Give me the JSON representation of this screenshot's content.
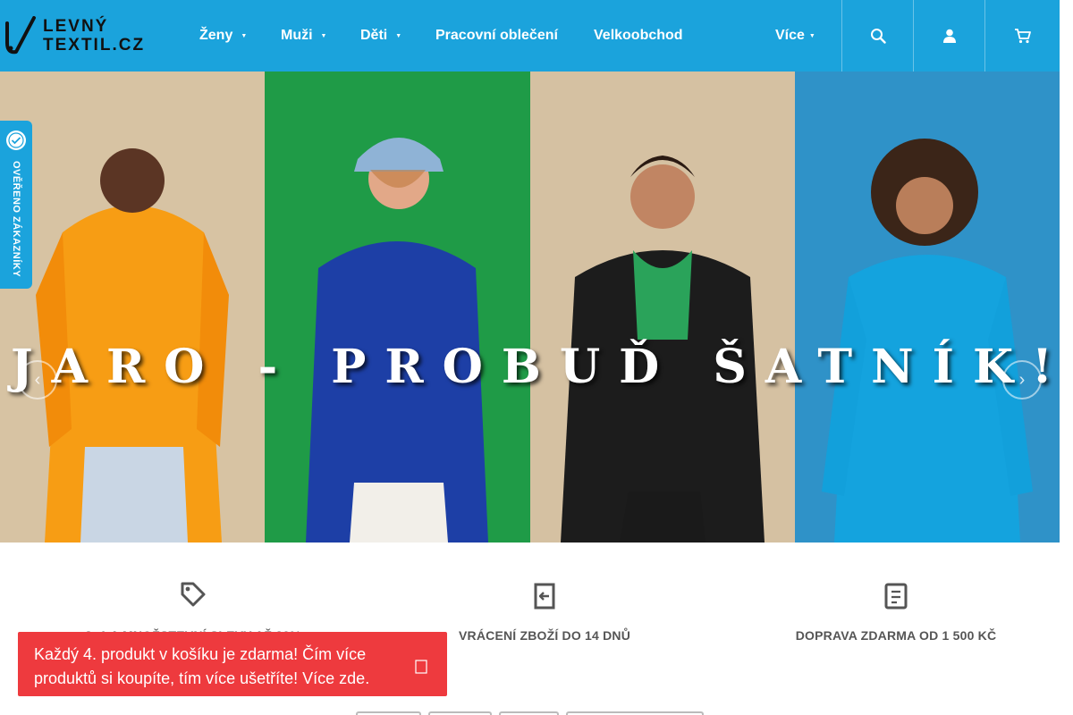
{
  "site": {
    "logo_line1": "LEVNÝ",
    "logo_line2": "TEXTIL.CZ"
  },
  "nav": {
    "items": [
      {
        "label": "Ženy",
        "has_dropdown": true
      },
      {
        "label": "Muži",
        "has_dropdown": true
      },
      {
        "label": "Děti",
        "has_dropdown": true
      },
      {
        "label": "Pracovní oblečení",
        "has_dropdown": false
      },
      {
        "label": "Velkoobchod",
        "has_dropdown": false
      },
      {
        "label": "Více",
        "has_dropdown": true
      }
    ],
    "icons": [
      "search-icon",
      "user-icon",
      "cart-icon"
    ]
  },
  "badge": {
    "label": "OVĚŘENO ZÁKAZNÍKY"
  },
  "hero": {
    "title": "JARO - PROBUĎ ŠATNÍK!",
    "panel_colors": [
      "#f79d14",
      "#1f9b47",
      "#d5c1a2",
      "#2f92c8"
    ]
  },
  "features": [
    {
      "label": "3+1 A MNOŽSTEVNÍ SLEVY AŽ 20%",
      "icon": "tag-icon"
    },
    {
      "label": "VRÁCENÍ ZBOŽÍ DO 14 DNŮ",
      "icon": "return-icon"
    },
    {
      "label": "DOPRAVA ZDARMA OD 1 500 KČ",
      "icon": "truck-icon"
    }
  ],
  "promo": {
    "text": "Každý 4. produkt v košíku je zdarma! Čím více produktů si koupíte, tím více ušetříte!",
    "link": "Více zde."
  },
  "colors": {
    "brand": "#1ba3dc",
    "promo": "#ee3a3e",
    "text_gray": "#555555"
  }
}
